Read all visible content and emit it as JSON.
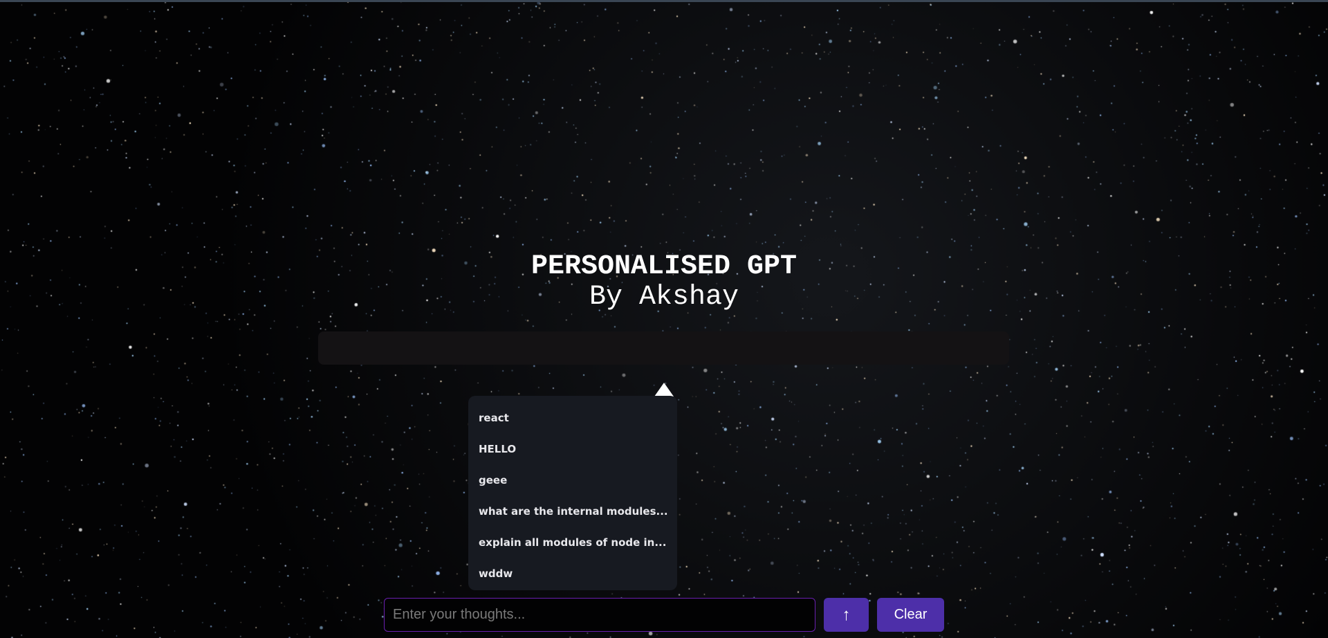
{
  "header": {
    "title": "PERSONALISED GPT",
    "subtitle": "By Akshay"
  },
  "history": {
    "items": [
      "react",
      "HELLO",
      "geee",
      "what are the internal modules...",
      "explain all modules of node in...",
      "wddw"
    ]
  },
  "composer": {
    "placeholder": "Enter your thoughts...",
    "value": "",
    "send_icon": "↑",
    "clear_label": "Clear"
  },
  "colors": {
    "accent": "#4d2fa9",
    "input_border": "#6a1fb0",
    "menu_bg": "#171a21"
  }
}
